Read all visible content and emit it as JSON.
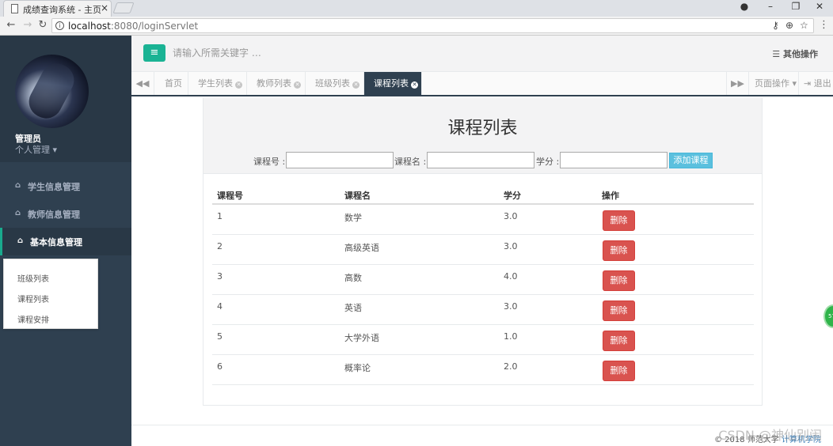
{
  "browser": {
    "tab_title": "成绩查询系统 - 主页",
    "tab_close": "×",
    "url_host": "localhost",
    "url_rest": ":8080/loginServlet",
    "win_controls": [
      "●",
      "–",
      "❐",
      "✕"
    ]
  },
  "sidebar": {
    "admin_name": "管理员",
    "admin_role": "个人管理 ▾",
    "items": [
      {
        "label": "学生信息管理",
        "icon": "home-icon"
      },
      {
        "label": "教师信息管理",
        "icon": "home-icon"
      },
      {
        "label": "基本信息管理",
        "icon": "home-icon"
      }
    ],
    "submenu": [
      "班级列表",
      "课程列表",
      "课程安排"
    ]
  },
  "topbar": {
    "menu_icon": "≡",
    "search_placeholder": "请输入所需关键字 …",
    "other_ops": "其他操作"
  },
  "page_tabs": [
    {
      "label": "首页",
      "closable": false
    },
    {
      "label": "学生列表",
      "closable": true
    },
    {
      "label": "教师列表",
      "closable": true
    },
    {
      "label": "班级列表",
      "closable": true
    },
    {
      "label": "课程列表",
      "closable": true,
      "active": true
    }
  ],
  "tab_ops": {
    "page_ops": "页面操作 ▾",
    "logout": "退出"
  },
  "course_panel": {
    "title": "课程列表",
    "filters": {
      "course_no_label": "课程号 :",
      "course_name_label": "课程名 :",
      "credit_label": "学分 :",
      "course_no_value": "",
      "course_name_value": "",
      "credit_value": ""
    },
    "add_button": "添加课程",
    "headers": [
      "课程号",
      "课程名",
      "学分",
      "操作"
    ],
    "delete_label": "删除",
    "rows": [
      {
        "id": "1",
        "name": "数学",
        "credit": "3.0"
      },
      {
        "id": "2",
        "name": "高级英语",
        "credit": "3.0"
      },
      {
        "id": "3",
        "name": "高数",
        "credit": "4.0"
      },
      {
        "id": "4",
        "name": "英语",
        "credit": "3.0"
      },
      {
        "id": "5",
        "name": "大学外语",
        "credit": "1.0"
      },
      {
        "id": "6",
        "name": "概率论",
        "credit": "2.0"
      }
    ]
  },
  "footer": {
    "copyright": "© 2018 ",
    "org": "师范大学",
    "link": "计算机学院"
  },
  "watermark": "CSDN @神仙别闹",
  "float_ball": "57"
}
